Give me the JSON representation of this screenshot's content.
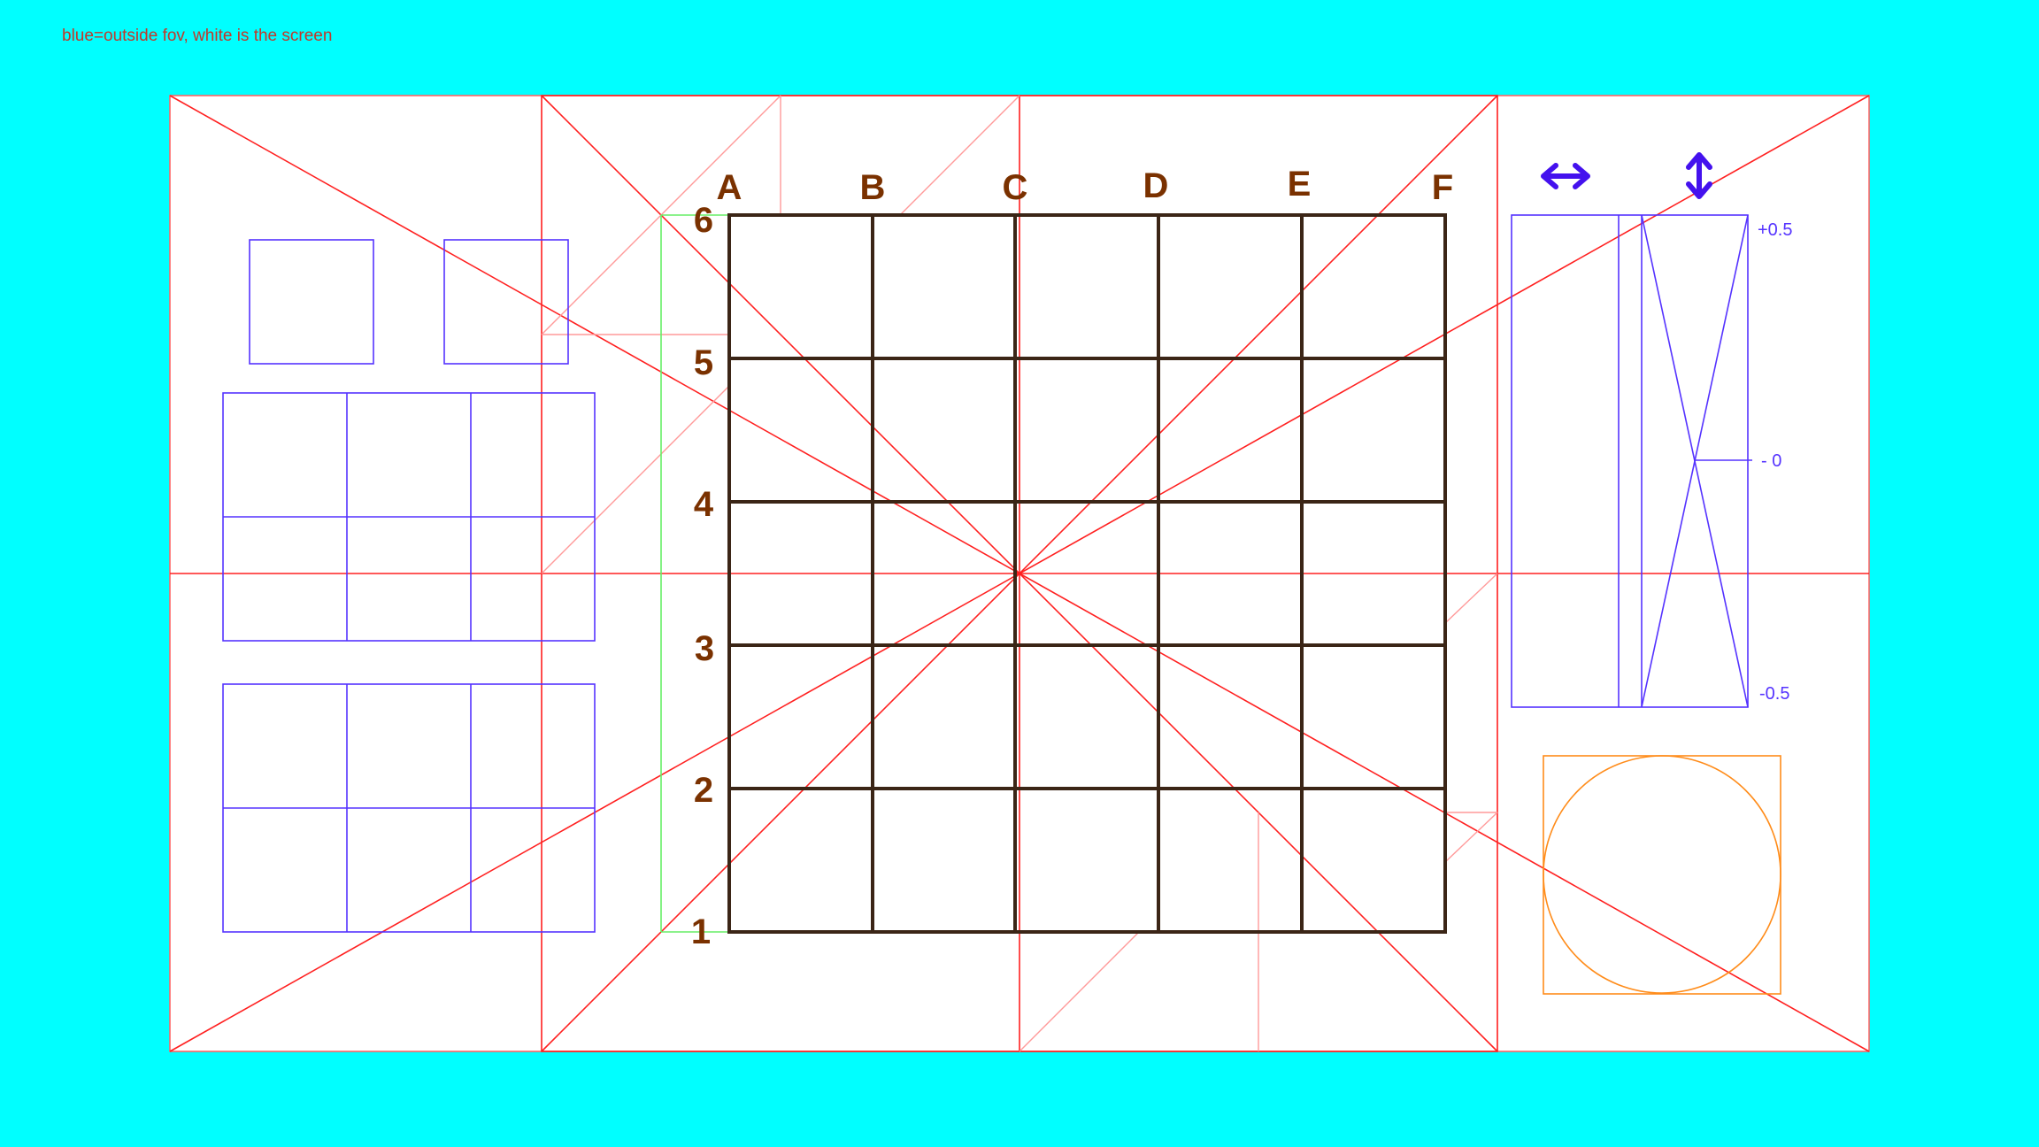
{
  "note": "blue=outside fov, white is the screen",
  "grid": {
    "columns": [
      "A",
      "B",
      "C",
      "D",
      "E",
      "F"
    ],
    "rows": [
      "6",
      "5",
      "4",
      "3",
      "2",
      "1"
    ]
  },
  "scale": {
    "top": "+0.5",
    "middle": "- 0",
    "bottom": "-0.5"
  },
  "icons": {
    "horizontal": "horizontal-double-arrow-icon",
    "vertical": "vertical-double-arrow-icon"
  },
  "colors": {
    "background": "#00ffff",
    "screen": "#ffffff",
    "guide": "#ff2020",
    "guide_light": "#ff9a9a",
    "grid": "#3b2516",
    "label": "#7a3100",
    "panel": "#5533ff",
    "margin": "#66ee66",
    "circle": "#ff8c1a"
  }
}
